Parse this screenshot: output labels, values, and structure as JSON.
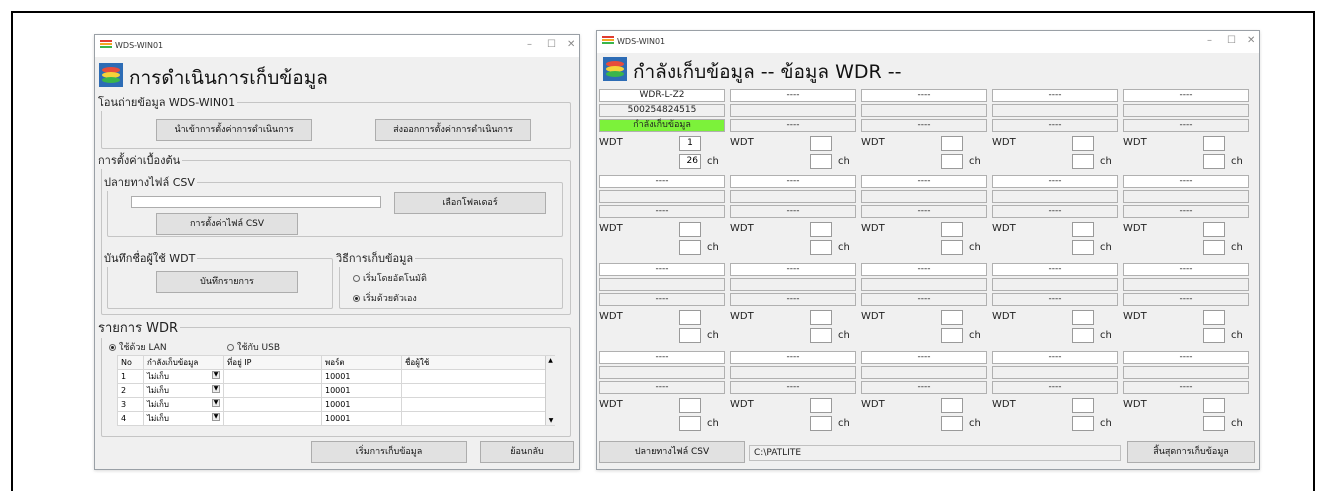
{
  "left_window": {
    "app_title": "WDS-WIN01",
    "heading": "การดำเนินการเก็บข้อมูล",
    "transfer": {
      "legend": "โอนถ่ายข้อมูล WDS-WIN01",
      "import_btn": "นำเข้าการตั้งค่าการดำเนินการ",
      "export_btn": "ส่งออกการตั้งค่าการดำเนินการ"
    },
    "initial": {
      "legend": "การตั้งค่าเบื้องต้น",
      "csv": {
        "legend": "ปลายทางไฟล์ CSV",
        "path": "",
        "select_folder_btn": "เลือกโฟลเดอร์",
        "csv_settings_btn": "การตั้งค่าไฟล์ CSV"
      },
      "user": {
        "legend": "บันทึกชื่อผู้ใช้ WDT",
        "record_btn": "บันทึกรายการ"
      },
      "method": {
        "legend": "วิธีการเก็บข้อมูล",
        "auto": "เริ่มโดยอัตโนมัติ",
        "manual": "เริ่มด้วยตัวเอง"
      }
    },
    "wdr_list": {
      "legend": "รายการ WDR",
      "lan": "ใช้ด้วย LAN",
      "usb": "ใช้กับ USB",
      "columns": [
        "No",
        "กำลังเก็บข้อมูล",
        "ที่อยู่ IP",
        "พอร์ต",
        "ชื่อผู้ใช้"
      ],
      "rows": [
        {
          "no": "1",
          "status": "ไม่เก็บ",
          "ip": "",
          "port": "10001",
          "user": ""
        },
        {
          "no": "2",
          "status": "ไม่เก็บ",
          "ip": "",
          "port": "10001",
          "user": ""
        },
        {
          "no": "3",
          "status": "ไม่เก็บ",
          "ip": "",
          "port": "10001",
          "user": ""
        },
        {
          "no": "4",
          "status": "ไม่เก็บ",
          "ip": "",
          "port": "10001",
          "user": ""
        }
      ]
    },
    "start_btn": "เริ่มการเก็บข้อมูล",
    "back_btn": "ย้อนกลับ"
  },
  "right_window": {
    "app_title": "WDS-WIN01",
    "heading": "กำลังเก็บข้อมูล -- ข้อมูล WDR --",
    "wdt_label": "WDT",
    "ch_label": "ch",
    "dash": "----",
    "first_cell": {
      "name": "WDR-L-Z2",
      "serial": "500254824515",
      "status": "กำลังเก็บข้อมูล",
      "wdt": "1",
      "ch": "26"
    },
    "csv_btn": "ปลายทางไฟล์ CSV",
    "csv_path": "C:\\PATLITE",
    "end_btn": "สิ้นสุดการเก็บข้อมูล"
  },
  "colors": {
    "collecting": "#7cf23a",
    "window_bg": "#f0f0f0"
  }
}
